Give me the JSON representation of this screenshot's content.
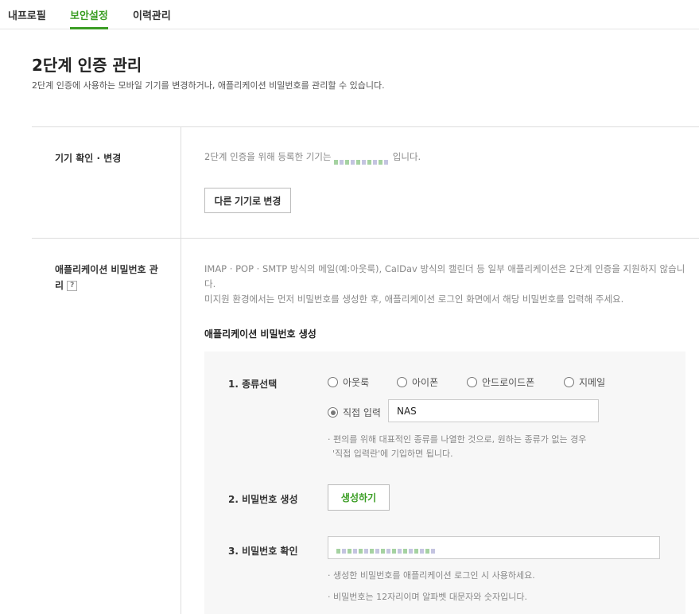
{
  "tabs": [
    "내프로필",
    "보안설정",
    "이력관리"
  ],
  "page": {
    "title": "2단계 인증 관리",
    "subtitle": "2단계 인증에 사용하는 모바일 기기를 변경하거나, 애플리케이션 비밀번호를 관리할 수 있습니다."
  },
  "device": {
    "label": "기기 확인 · 변경",
    "text_before": "2단계 인증을 위해 등록한 기기는",
    "text_after": "입니다.",
    "change_button": "다른 기기로 변경"
  },
  "app_pw": {
    "label": "애플리케이션 비밀번호 관리",
    "help": "?",
    "desc1": "IMAP · POP · SMTP 방식의 메일(예:아웃룩), CalDav 방식의 캘린더 등 일부 애플리케이션은 2단계 인증을 지원하지 않습니다.",
    "desc2": "미지원 환경에서는 먼저 비밀번호를 생성한 후, 애플리케이션 로그인 화면에서 해당 비밀번호를 입력해 주세요.",
    "section_title": "애플리케이션 비밀번호 생성",
    "step1": "1. 종류선택",
    "options": [
      "아웃룩",
      "아이폰",
      "안드로이드폰",
      "지메일",
      "직접 입력"
    ],
    "custom_value": "NAS",
    "note1a": "· 편의를 위해 대표적인 종류를 나열한 것으로, 원하는 종류가 없는 경우",
    "note1b": "'직접 입력란'에 기입하면 됩니다.",
    "step2": "2. 비밀번호 생성",
    "generate_button": "생성하기",
    "step3": "3. 비밀번호 확인",
    "note3a": "· 생성한 비밀번호를 애플리케이션 로그인 시 사용하세요.",
    "note3b": "· 비밀번호는 12자리이며 알파벳 대문자와 숫자입니다."
  },
  "colors": {
    "accent": "#3a9d23"
  }
}
